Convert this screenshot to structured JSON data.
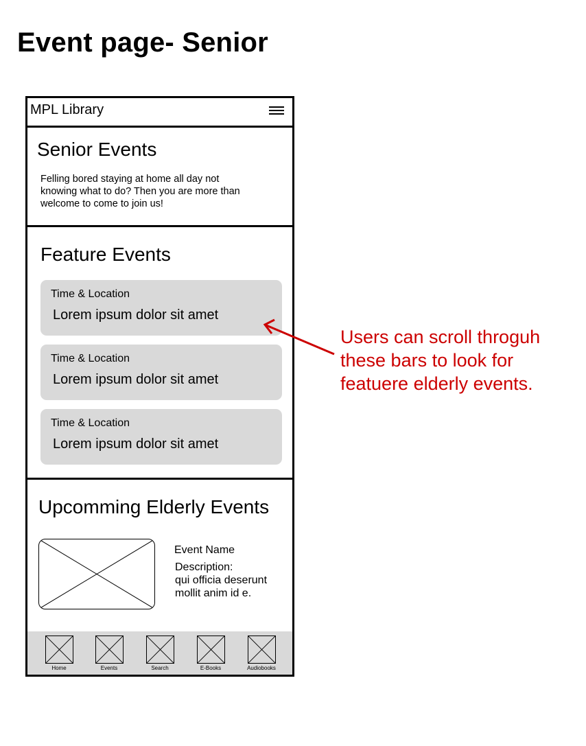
{
  "page_title": "Event page- Senior",
  "phone": {
    "topbar": {
      "app_title": "MPL Library",
      "menu_icon": "hamburger-menu-icon"
    },
    "intro": {
      "heading": "Senior Events",
      "text": "Felling bored staying at home all day not knowing what to do? Then you are more than welcome to come to join us!"
    },
    "featured": {
      "heading": "Feature Events",
      "cards": [
        {
          "meta": "Time & Location",
          "title": "Lorem ipsum dolor sit amet"
        },
        {
          "meta": "Time & Location",
          "title": "Lorem ipsum dolor sit amet"
        },
        {
          "meta": "Time & Location",
          "title": "Lorem ipsum dolor sit amet"
        }
      ]
    },
    "upcoming": {
      "heading": "Upcomming Elderly Events",
      "event_name": "Event Name",
      "description": "Description:\nqui officia deserunt mollit anim id e."
    },
    "bottom_nav": [
      {
        "label": "Home"
      },
      {
        "label": "Events"
      },
      {
        "label": "Search"
      },
      {
        "label": "E-Books"
      },
      {
        "label": "Audiobooks"
      }
    ]
  },
  "annotation": {
    "text": "Users can scroll throguh these bars to look for featuere elderly events.",
    "color": "#cc0000"
  }
}
